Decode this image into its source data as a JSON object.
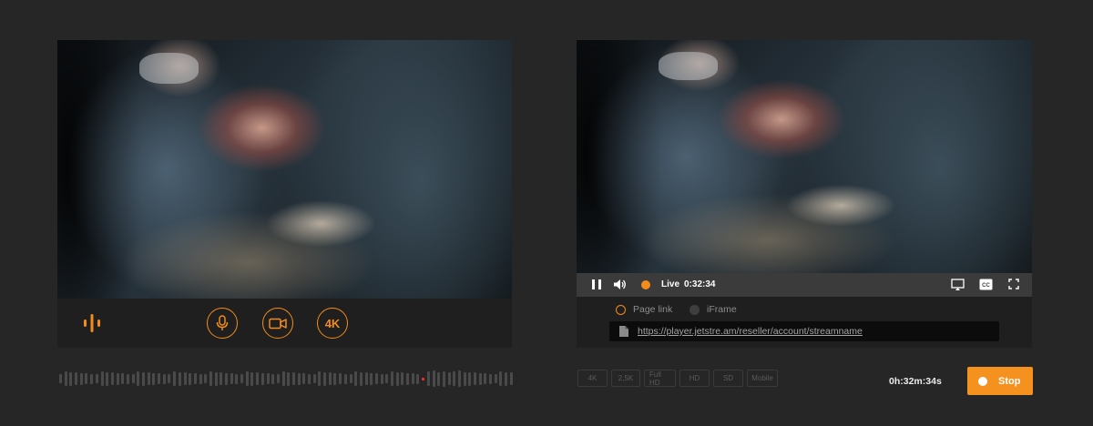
{
  "colors": {
    "accent": "#f28c1a",
    "background": "#262626",
    "panel": "#1c1c1c",
    "peak": "#ff2a2a"
  },
  "broadcaster": {
    "icons": {
      "audio": "audio-levels-icon",
      "mic": "microphone-icon",
      "camera": "video-camera-icon"
    },
    "resolution_label": "4K",
    "level_meter": {
      "peak_index": 70,
      "bar_count": 88
    }
  },
  "viewer": {
    "player": {
      "live_label": "Live",
      "time": "0:32:34",
      "icons": {
        "pause": "pause-icon",
        "volume": "volume-icon",
        "cast": "cast-icon",
        "captions": "closed-captions-icon",
        "fullscreen": "fullscreen-icon"
      }
    },
    "embed": {
      "options": [
        {
          "label": "Page link",
          "selected": true
        },
        {
          "label": "iFrame",
          "selected": false
        }
      ],
      "link": "https://player.jetstre.am/reseller/account/streamname"
    },
    "quality_options": [
      "4K",
      "2,5K",
      "Full HD",
      "HD",
      "SD",
      "Mobile"
    ],
    "elapsed": "0h:32m:34s",
    "stop_label": "Stop"
  }
}
